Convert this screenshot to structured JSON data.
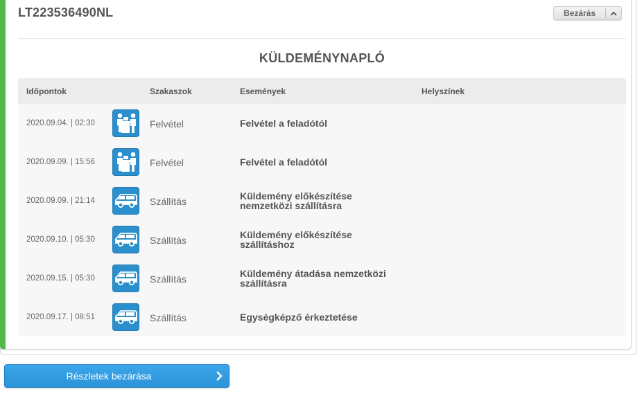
{
  "card": {
    "tracking_number": "LT223536490NL",
    "close_label": "Bezárás",
    "accent_color": "#52b848"
  },
  "log": {
    "title": "KÜLDEMÉNYNAPLÓ",
    "headers": {
      "time": "Időpontok",
      "stage": "Szakaszok",
      "event": "Események",
      "location": "Helyszínek"
    },
    "rows": [
      {
        "date": "2020.09.04. | 02:30",
        "icon": "handover-icon",
        "stage": "Felvétel",
        "event": "Felvétel a feladótól",
        "location": ""
      },
      {
        "date": "2020.09.09. | 15:56",
        "icon": "handover-icon",
        "stage": "Felvétel",
        "event": "Felvétel a feladótól",
        "location": ""
      },
      {
        "date": "2020.09.09. | 21:14",
        "icon": "delivery-van-icon",
        "stage": "Szállítás",
        "event": "Küldemény előkészítése nemzetközi szállításra",
        "location": ""
      },
      {
        "date": "2020.09.10. | 05:30",
        "icon": "delivery-van-icon",
        "stage": "Szállítás",
        "event": "Küldemény előkészítése szállításhoz",
        "location": ""
      },
      {
        "date": "2020.09.15. | 05:30",
        "icon": "delivery-van-icon",
        "stage": "Szállítás",
        "event": "Küldemény átadása nemzetközi szállításra",
        "location": ""
      },
      {
        "date": "2020.09.17. | 08:51",
        "icon": "delivery-van-icon",
        "stage": "Szállítás",
        "event": "Egységképző érkeztetése",
        "location": ""
      }
    ]
  },
  "footer": {
    "close_details_label": "Részletek bezárása",
    "button_color": "#2b93d8"
  }
}
